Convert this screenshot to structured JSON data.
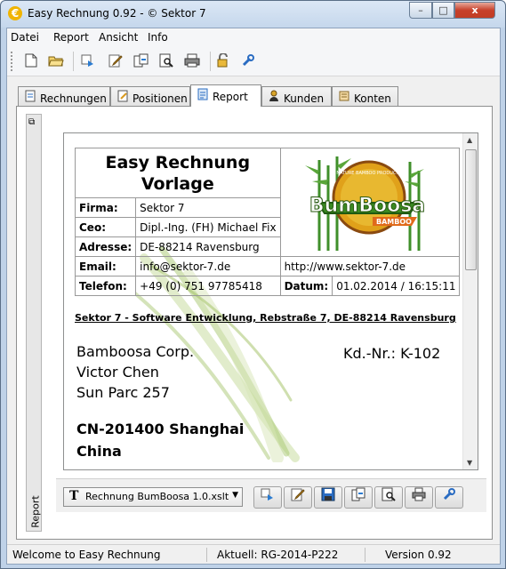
{
  "window": {
    "title": "Easy Rechnung 0.92 - © Sektor 7",
    "icon_glyph": "€",
    "controls": {
      "minimize": "–",
      "maximize": "□",
      "close": "x"
    }
  },
  "menu": [
    "Datei",
    "Report",
    "Ansicht",
    "Info"
  ],
  "toolbar_icons": [
    "new-file-icon",
    "open-folder-icon",
    "refresh-icon",
    "edit-icon",
    "export-icon",
    "preview-icon",
    "print-icon",
    "lock-icon",
    "settings-icon"
  ],
  "tabs": [
    {
      "label": "Rechnungen",
      "icon": "invoice-icon"
    },
    {
      "label": "Positionen",
      "icon": "positions-icon"
    },
    {
      "label": "Report",
      "icon": "report-icon",
      "active": true
    },
    {
      "label": "Kunden",
      "icon": "customers-icon"
    },
    {
      "label": "Konten",
      "icon": "accounts-icon"
    }
  ],
  "side_panel": {
    "label": "Report",
    "pin_glyph": "⧉"
  },
  "report": {
    "title_line1": "Easy Rechnung",
    "title_line2": "Vorlage",
    "rows": [
      {
        "label": "Firma:",
        "value": "Sektor 7"
      },
      {
        "label": "Ceo:",
        "value": "Dipl.-Ing. (FH) Michael Fix"
      },
      {
        "label": "Adresse:",
        "value": "DE-88214 Ravensburg"
      }
    ],
    "email_label": "Email:",
    "email_value": "info@sektor-7.de",
    "website": "http://www.sektor-7.de",
    "phone_label": "Telefon:",
    "phone_value": "+49 (0) 751 97785418",
    "date_label": "Datum:",
    "date_value": "01.02.2014 / 16:15:11",
    "logo": {
      "text": "BumBoosa",
      "sub": "BAMBOO",
      "ring_text": "NATURE BAMBOO PRODUCTS"
    },
    "sender_line": "Sektor 7 - Software Entwicklung, Rebstraße 7, DE-88214 Ravensburg",
    "recipient": {
      "company": "Bamboosa Corp.",
      "person": "Victor Chen",
      "street": "Sun Parc 257",
      "city": "CN-201400 Shanghai",
      "country": "China"
    },
    "customer_number": "Kd.-Nr.: K-102"
  },
  "template_select": {
    "value": "Rechnung BumBoosa 1.0.xslt",
    "icon_glyph": "T"
  },
  "bottom_buttons": [
    "refresh-icon",
    "edit-icon",
    "save-icon",
    "export-icon",
    "preview-icon",
    "print-icon",
    "settings-icon"
  ],
  "status": {
    "message": "Welcome to Easy Rechnung",
    "current": "Aktuell: RG-2014-P222",
    "version": "Version 0.92"
  }
}
